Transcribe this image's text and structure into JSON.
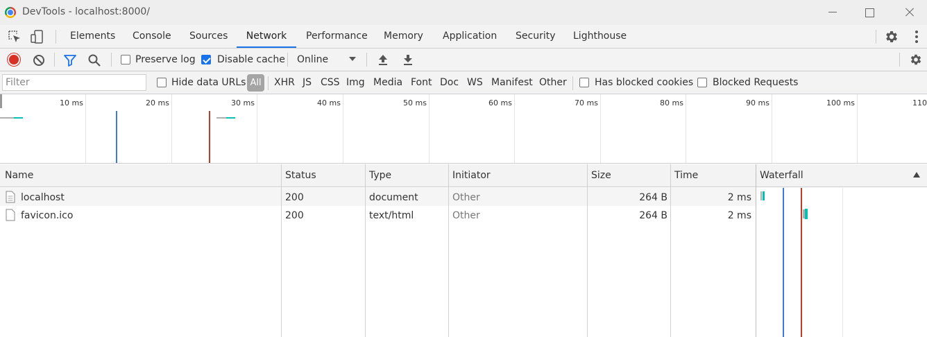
{
  "window": {
    "title": "DevTools - localhost:8000/"
  },
  "tabs": [
    "Elements",
    "Console",
    "Sources",
    "Network",
    "Performance",
    "Memory",
    "Application",
    "Security",
    "Lighthouse"
  ],
  "active_tab": "Network",
  "toolbar": {
    "preserve_log_label": "Preserve log",
    "preserve_log_checked": false,
    "disable_cache_label": "Disable cache",
    "disable_cache_checked": true,
    "throttling_value": "Online"
  },
  "filter": {
    "placeholder": "Filter",
    "hide_data_urls_label": "Hide data URLs",
    "types": [
      "All",
      "XHR",
      "JS",
      "CSS",
      "Img",
      "Media",
      "Font",
      "Doc",
      "WS",
      "Manifest",
      "Other"
    ],
    "selected_type": "All",
    "has_blocked_cookies_label": "Has blocked cookies",
    "blocked_requests_label": "Blocked Requests"
  },
  "overview": {
    "ticks": [
      "10 ms",
      "20 ms",
      "30 ms",
      "40 ms",
      "50 ms",
      "60 ms",
      "70 ms",
      "80 ms",
      "90 ms",
      "100 ms",
      "110"
    ],
    "dom_content_loaded_ms": 13.6,
    "load_ms": 24.4
  },
  "table": {
    "columns": [
      "Name",
      "Status",
      "Type",
      "Initiator",
      "Size",
      "Time",
      "Waterfall"
    ],
    "rows": [
      {
        "name": "localhost",
        "status": "200",
        "type": "document",
        "initiator": "Other",
        "size": "264 B",
        "time": "2 ms"
      },
      {
        "name": "favicon.ico",
        "status": "200",
        "type": "text/html",
        "initiator": "Other",
        "size": "264 B",
        "time": "2 ms"
      }
    ]
  },
  "colors": {
    "accent": "#1a73e8",
    "record": "#d93025",
    "dom_content_loaded_line": "#3b78e7",
    "load_line": "#c53929",
    "waterfall_bar": "#00c1b2"
  }
}
